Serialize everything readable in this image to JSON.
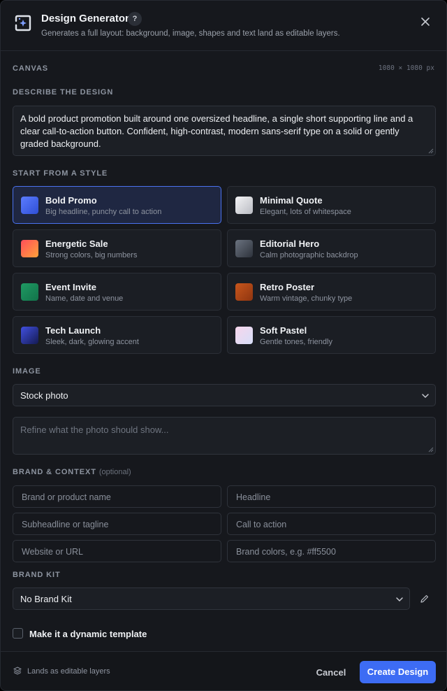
{
  "header": {
    "title": "Design Generator",
    "help_label": "?",
    "subtitle": "Generates a full layout: background, image, shapes and text land as editable layers.",
    "close_icon": "close-icon"
  },
  "canvas": {
    "label": "CANVAS",
    "size": "1080 × 1080 px"
  },
  "describe": {
    "label": "DESCRIBE THE DESIGN",
    "value": "A bold product promotion built around one oversized headline, a single short supporting line and a clear call-to-action button. Confident, high-contrast, modern sans-serif type on a solid or gently graded background."
  },
  "styles": {
    "label": "START FROM A STYLE",
    "items": [
      {
        "title": "Bold Promo",
        "desc": "Big headline, punchy call to action",
        "selected": true,
        "color_a": "#5b7cff",
        "color_b": "#2f4fd6"
      },
      {
        "title": "Minimal Quote",
        "desc": "Elegant, lots of whitespace",
        "selected": false,
        "color_a": "#f4f4f6",
        "color_b": "#b9bbc2"
      },
      {
        "title": "Energetic Sale",
        "desc": "Strong colors, big numbers",
        "selected": false,
        "color_a": "#ff4f5a",
        "color_b": "#ffa23a"
      },
      {
        "title": "Editorial Hero",
        "desc": "Calm photographic backdrop",
        "selected": false,
        "color_a": "#6b7380",
        "color_b": "#2d323b"
      },
      {
        "title": "Event Invite",
        "desc": "Name, date and venue",
        "selected": false,
        "color_a": "#1f9a63",
        "color_b": "#12734a"
      },
      {
        "title": "Retro Poster",
        "desc": "Warm vintage, chunky type",
        "selected": false,
        "color_a": "#c8561c",
        "color_b": "#8e3510"
      },
      {
        "title": "Tech Launch",
        "desc": "Sleek, dark, glowing accent",
        "selected": false,
        "color_a": "#4150e0",
        "color_b": "#141a52"
      },
      {
        "title": "Soft Pastel",
        "desc": "Gentle tones, friendly",
        "selected": false,
        "color_a": "#f7d6ec",
        "color_b": "#d6def8"
      }
    ]
  },
  "image": {
    "label": "IMAGE",
    "selected": "Stock photo",
    "refine_placeholder": "Refine what the photo should show..."
  },
  "brand": {
    "label": "BRAND & CONTEXT",
    "optional": "(optional)",
    "fields": [
      "Brand or product name",
      "Headline",
      "Subheadline or tagline",
      "Call to action",
      "Website or URL",
      "Brand colors, e.g. #ff5500"
    ]
  },
  "brand_kit": {
    "label": "BRAND KIT",
    "selected": "No Brand Kit"
  },
  "dynamic": {
    "label": "Make it a dynamic template",
    "checked": false
  },
  "footer": {
    "note": "Lands as editable layers",
    "cancel": "Cancel",
    "create": "Create Design"
  },
  "colors": {
    "accent": "#3d6cf4",
    "panel": "#16181d"
  }
}
